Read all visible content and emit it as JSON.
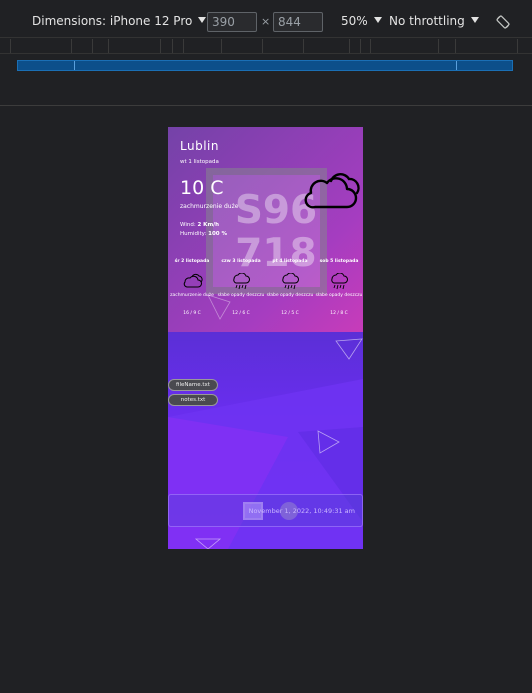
{
  "devtools": {
    "dimensions_label": "Dimensions: iPhone 12 Pro",
    "width_value": "390",
    "height_value": "844",
    "times_sign": "×",
    "zoom": "50%",
    "throttling": "No throttling",
    "rotate_icon": "rotate-icon"
  },
  "weather": {
    "city": "Lublin",
    "date": "wt 1 listopada",
    "temperature": "10 C",
    "condition": "zachmurzenie duże",
    "wind_label": "Wind: ",
    "wind_value": "2 Km/h",
    "humidity_label": "Humidity: ",
    "humidity_value": "100 %",
    "icon": "cloud-icon",
    "forecast": [
      {
        "day": "śr 2 listopada",
        "icon": "cloud-icon",
        "condition": "zachmurzenie duże",
        "temps": "16 / 9 C"
      },
      {
        "day": "czw 3 listopada",
        "icon": "rain-cloud-icon",
        "condition": "słabe opady deszczu",
        "temps": "12 / 6 C"
      },
      {
        "day": "pt 4 listopada",
        "icon": "rain-cloud-icon",
        "condition": "słabe opady deszczu",
        "temps": "12 / 5 C"
      },
      {
        "day": "sob 5 listopada",
        "icon": "rain-cloud-icon",
        "condition": "słabe opady deszczu",
        "temps": "12 / 8 C"
      }
    ]
  },
  "captcha": {
    "line1": "S96",
    "line2": "718"
  },
  "files": [
    "fileName.txt",
    "notes.txt"
  ],
  "status": {
    "timestamp": "November 1, 2022, 10:49:31 am"
  },
  "colors": {
    "devtools_bg": "#202124",
    "media_query_bar": "#0c4f8a",
    "accent_pink": "#f040a8",
    "accent_purple": "#6a2ef0"
  }
}
